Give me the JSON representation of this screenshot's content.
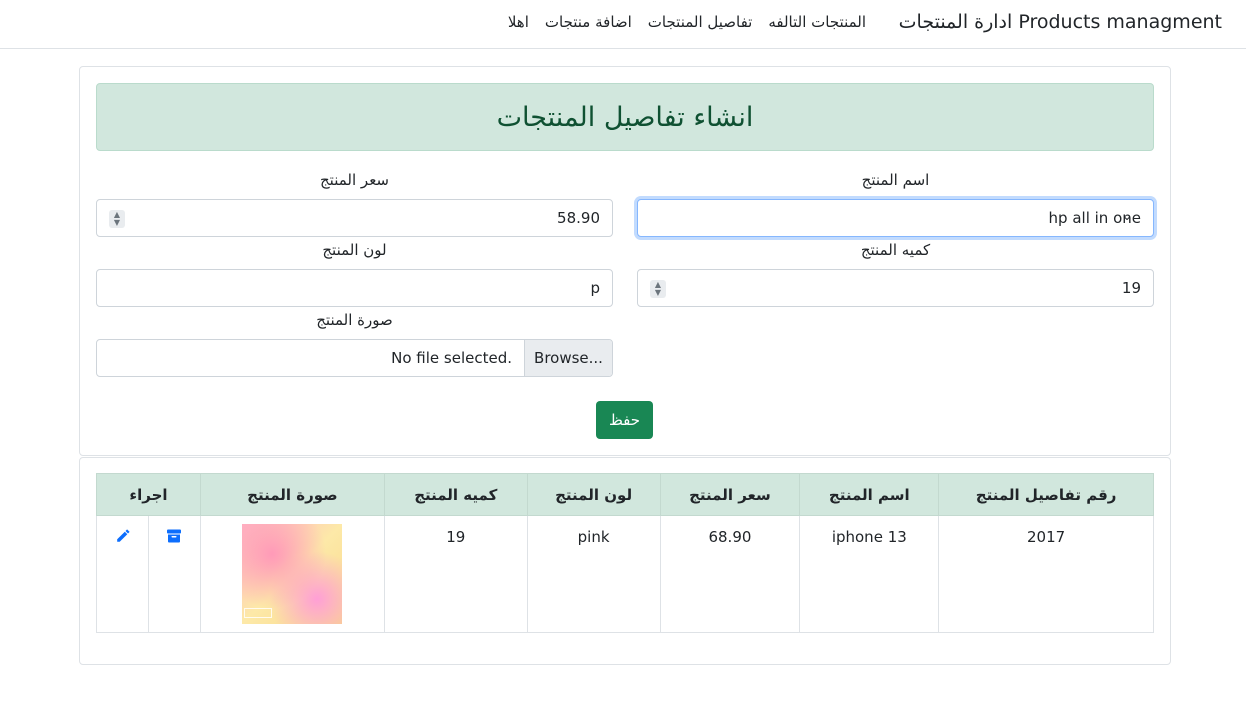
{
  "navbar": {
    "brand": "Products managment ادارة المنتجات",
    "links": [
      "اهلا",
      "اضافة منتجات",
      "تفاصيل المنتجات",
      "المنتجات التالفه"
    ]
  },
  "form": {
    "title": "انشاء تفاصيل المنتجات",
    "product_name_label": "اسم المنتج",
    "product_name_value": "hp all in one",
    "product_price_label": "سعر المنتج",
    "product_price_value": "58.90",
    "product_quantity_label": "كميه المنتج",
    "product_quantity_value": "19",
    "product_color_label": "لون المنتج",
    "product_color_value": "p",
    "product_image_label": "صورة المنتج",
    "file_button_label": "Browse...",
    "file_status": "No file selected.",
    "save_label": "حفظ"
  },
  "table": {
    "headers": [
      "رقم تفاصيل المنتج",
      "اسم المنتج",
      "سعر المنتج",
      "لون المنتج",
      "كميه المنتج",
      "صورة المنتج",
      "اجراء"
    ],
    "rows": [
      {
        "id": "2017",
        "name": "iphone 13",
        "price": "68.90",
        "color": "pink",
        "quantity": "19",
        "image_icon": "product-thumbnail"
      }
    ]
  },
  "colors": {
    "accent_success": "#198754",
    "title_bg": "#d1e7dd",
    "title_text": "#0f5132",
    "action_icon": "#0d6efd"
  },
  "icons": [
    "archive-icon",
    "edit-pencil-icon"
  ]
}
